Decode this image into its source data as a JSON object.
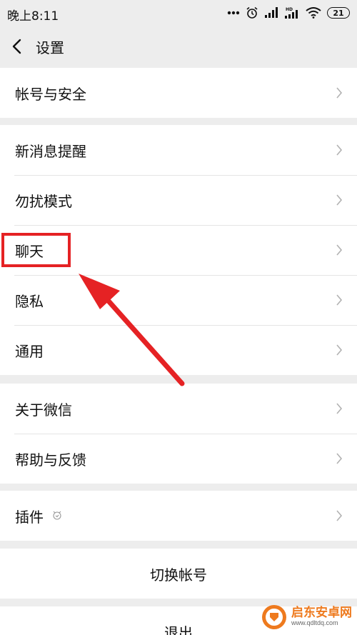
{
  "status_bar": {
    "time": "晚上8:11",
    "battery": "21",
    "icons": [
      "more-dots-icon",
      "alarm-icon",
      "signal-icon",
      "hd-signal-icon",
      "wifi-icon",
      "battery-icon"
    ]
  },
  "nav": {
    "title": "设置",
    "back_icon": "chevron-left-icon"
  },
  "groups": {
    "account": {
      "items": [
        {
          "label": "帐号与安全"
        }
      ]
    },
    "settings": {
      "items": [
        {
          "label": "新消息提醒"
        },
        {
          "label": "勿扰模式"
        },
        {
          "label": "聊天"
        },
        {
          "label": "隐私"
        },
        {
          "label": "通用"
        }
      ]
    },
    "about": {
      "items": [
        {
          "label": "关于微信"
        },
        {
          "label": "帮助与反馈"
        }
      ]
    },
    "plugins": {
      "items": [
        {
          "label": "插件"
        }
      ]
    }
  },
  "actions": {
    "switch_account": "切换帐号",
    "logout": "退出"
  },
  "annotation": {
    "highlight_color": "#e52224"
  },
  "watermark": {
    "title": "启东安卓网",
    "url": "www.qdltdq.com"
  },
  "colors": {
    "background": "#ededed",
    "card": "#ffffff",
    "divider": "#e5e5e5",
    "chevron": "#b2b2b2",
    "annotation": "#e52224"
  }
}
